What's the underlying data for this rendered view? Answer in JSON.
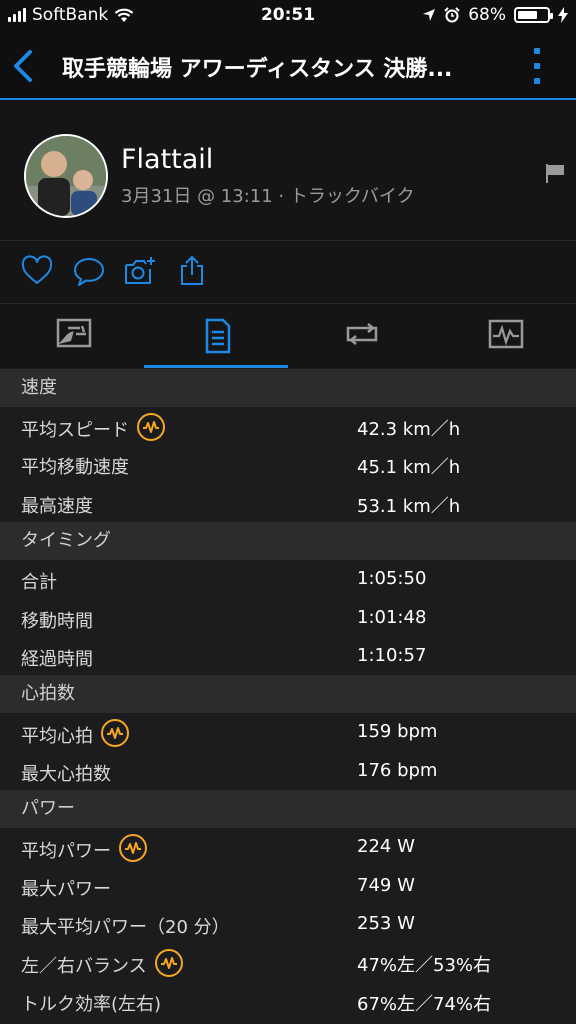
{
  "status_bar": {
    "carrier": "SoftBank",
    "time": "20:51",
    "battery_percent": "68%",
    "battery_level": 0.68
  },
  "nav": {
    "title": "取手競輪場 アワーディスタンス 決勝...",
    "back_icon": "chevron-left-icon",
    "more_icon": "vertical-dots-icon",
    "accent_color": "#1e88e5"
  },
  "activity": {
    "user_name": "Flattail",
    "meta": "3月31日 @ 13:11 · トラックバイク"
  },
  "actions": [
    "heart-icon",
    "comment-icon",
    "add-photo-icon",
    "share-icon"
  ],
  "tabs": [
    {
      "name": "overview-icon",
      "selected": false
    },
    {
      "name": "stats-icon",
      "selected": true
    },
    {
      "name": "laps-icon",
      "selected": false
    },
    {
      "name": "charts-icon",
      "selected": false
    }
  ],
  "sections": [
    {
      "title": "速度",
      "rows": [
        {
          "label": "平均スピード",
          "value": "42.3 km／h",
          "badge": true
        },
        {
          "label": "平均移動速度",
          "value": "45.1 km／h",
          "badge": false
        },
        {
          "label": "最高速度",
          "value": "53.1 km／h",
          "badge": false
        }
      ]
    },
    {
      "title": "タイミング",
      "rows": [
        {
          "label": "合計",
          "value": "1:05:50",
          "badge": false
        },
        {
          "label": "移動時間",
          "value": "1:01:48",
          "badge": false
        },
        {
          "label": "経過時間",
          "value": "1:10:57",
          "badge": false
        }
      ]
    },
    {
      "title": "心拍数",
      "rows": [
        {
          "label": "平均心拍",
          "value": "159 bpm",
          "badge": true
        },
        {
          "label": "最大心拍数",
          "value": "176 bpm",
          "badge": false
        }
      ]
    },
    {
      "title": "パワー",
      "rows": [
        {
          "label": "平均パワー",
          "value": "224 W",
          "badge": true
        },
        {
          "label": "最大パワー",
          "value": "749 W",
          "badge": false
        },
        {
          "label": "最大平均パワー（20 分）",
          "value": "253 W",
          "badge": false
        },
        {
          "label": "左／右バランス",
          "value": "47%左／53%右",
          "badge": true
        },
        {
          "label": "トルク効率(左右)",
          "value": "67%左／74%右",
          "badge": false
        }
      ]
    }
  ]
}
